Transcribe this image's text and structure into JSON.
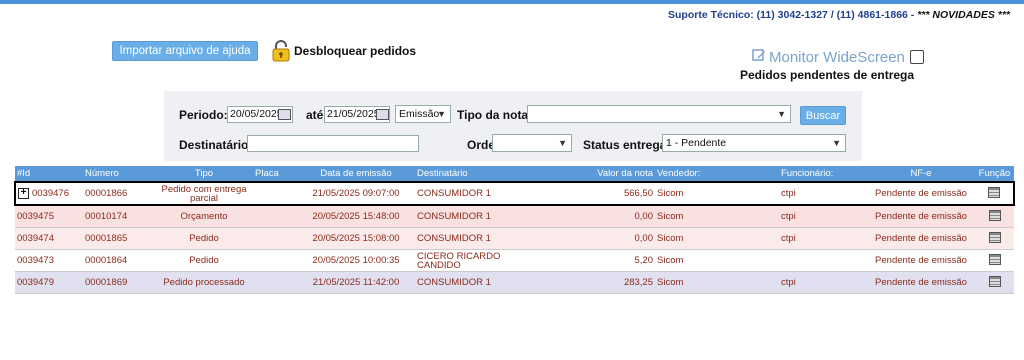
{
  "header": {
    "support_text": "Suporte Técnico: (11) 3042-1327 / (11) 4861-1866 - ",
    "news_text": "*** NOVIDADES ***"
  },
  "actions": {
    "import_label": "Importar arquivo de ajuda",
    "unlock_label": "Desbloquear pedidos",
    "monitor_label": "Monitor WideScreen",
    "pending_title": "Pedidos pendentes de entrega"
  },
  "filters": {
    "periodo_label": "Periodo:",
    "periodo_from": "20/05/2025",
    "ate_label": "até",
    "periodo_to": "21/05/2025",
    "date_type": "Emissão",
    "tipo_nota_label": "Tipo da nota:",
    "tipo_nota_value": "",
    "buscar_label": "Buscar",
    "destinatario_label": "Destinatário:",
    "destinatario_value": "",
    "ordem_label": "Ordem:",
    "ordem_value": "",
    "status_label": "Status entrega:",
    "status_value": "1 - Pendente"
  },
  "table": {
    "columns": [
      "#Id",
      "Número",
      "Tipo",
      "Placa",
      "Data de emissão",
      "Destinatário",
      "Valor da nota",
      "Vendedor:",
      "Funcionário:",
      "NF-e",
      "Função"
    ],
    "rows": [
      {
        "id": "0039476",
        "numero": "00001866",
        "tipo": "Pedido com entrega parcial",
        "placa": "",
        "data": "21/05/2025 09:07:00",
        "dest": "CONSUMIDOR 1",
        "valor": "566,50",
        "vendedor": "Sicom",
        "funcionario": "ctpi",
        "nfe": "Pendente de emissão"
      },
      {
        "id": "0039475",
        "numero": "00010174",
        "tipo": "Orçamento",
        "placa": "",
        "data": "20/05/2025 15:48:00",
        "dest": "CONSUMIDOR 1",
        "valor": "0,00",
        "vendedor": "Sicom",
        "funcionario": "ctpi",
        "nfe": "Pendente de emissão"
      },
      {
        "id": "0039474",
        "numero": "00001865",
        "tipo": "Pedido",
        "placa": "",
        "data": "20/05/2025 15:08:00",
        "dest": "CONSUMIDOR 1",
        "valor": "0,00",
        "vendedor": "Sicom",
        "funcionario": "ctpi",
        "nfe": "Pendente de emissão"
      },
      {
        "id": "0039473",
        "numero": "00001864",
        "tipo": "Pedido",
        "placa": "",
        "data": "20/05/2025 10:00:35",
        "dest": "CICERO RICARDO CANDIDO",
        "valor": "5,20",
        "vendedor": "Sicom",
        "funcionario": "",
        "nfe": "Pendente de emissão"
      },
      {
        "id": "0039479",
        "numero": "00001869",
        "tipo": "Pedido processado",
        "placa": "",
        "data": "21/05/2025 11:42:00",
        "dest": "CONSUMIDOR 1",
        "valor": "283,25",
        "vendedor": "Sicom",
        "funcionario": "ctpi",
        "nfe": "Pendente de emissão"
      }
    ]
  },
  "colors": {
    "accent": "#5a9ad8",
    "row_text": "#8b2a1a",
    "support_text": "#1f3f8f"
  }
}
